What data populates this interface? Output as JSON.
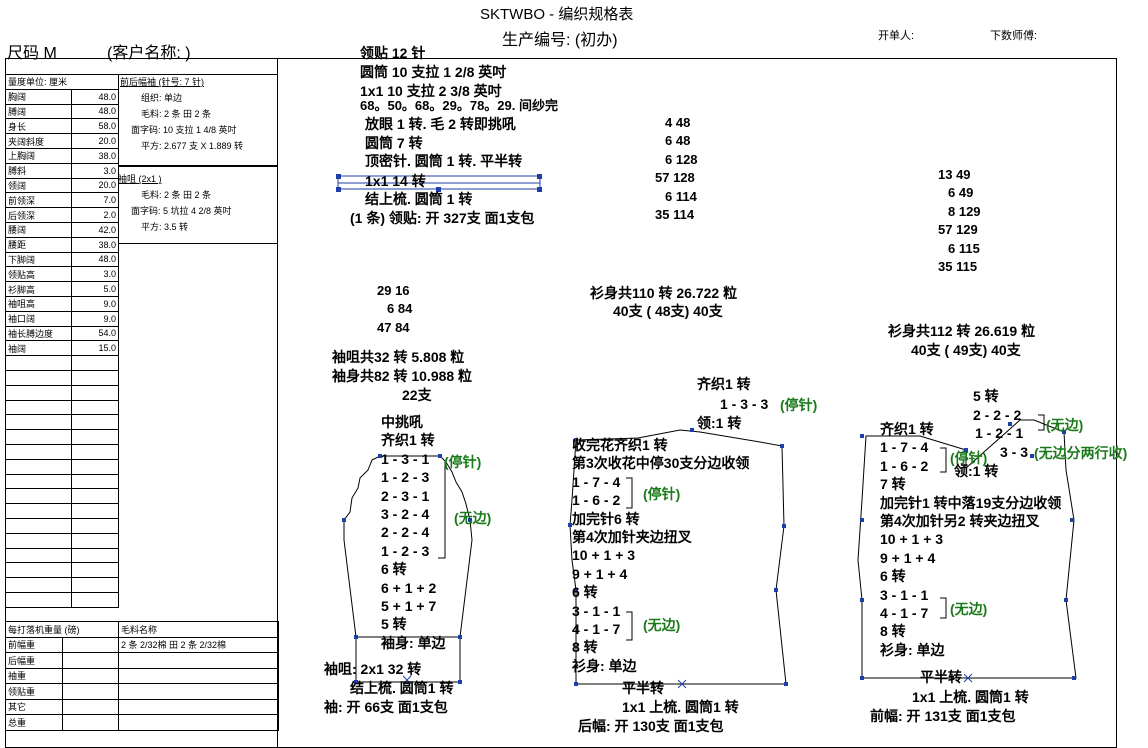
{
  "header": {
    "title": "SKTWBO - 编织规格表",
    "production_no": "生产编号: (初办)",
    "size": "尺码  M",
    "customer": "(客户名称:                  )",
    "issuer": "开单人:",
    "technician": "下数师傅:"
  },
  "measurements": {
    "header": "量度单位: 厘米",
    "rows": [
      {
        "label": "胸阔",
        "value": "48.0"
      },
      {
        "label": "膊阔",
        "value": "48.0"
      },
      {
        "label": "身长",
        "value": "58.0"
      },
      {
        "label": "夹阔斜度",
        "value": "20.0"
      },
      {
        "label": "上胸阔",
        "value": "38.0"
      },
      {
        "label": "膊斜",
        "value": "3.0"
      },
      {
        "label": "领阔",
        "value": "20.0"
      },
      {
        "label": "前领深",
        "value": "7.0"
      },
      {
        "label": "后领深",
        "value": "2.0"
      },
      {
        "label": "腰阔",
        "value": "42.0"
      },
      {
        "label": "腰距",
        "value": "38.0"
      },
      {
        "label": "下脚阔",
        "value": "48.0"
      },
      {
        "label": "领贴高",
        "value": "3.0"
      },
      {
        "label": "衫脚高",
        "value": "5.0"
      },
      {
        "label": "袖咀高",
        "value": "9.0"
      },
      {
        "label": "袖口阔",
        "value": "9.0"
      },
      {
        "label": "袖长膊边度",
        "value": "54.0"
      },
      {
        "label": "袖阔",
        "value": "15.0"
      }
    ]
  },
  "spec_body": {
    "title": "前后幅袖 (针号: 7 针)",
    "lines": [
      "组织: 单边",
      "毛料: 2 条 田 2 条",
      "面字码: 10 支拉 1 4/8 英吋",
      "平方: 2.677 支 X 1.889 转"
    ]
  },
  "spec_rib": {
    "title": "袖咀 (2x1 )",
    "lines": [
      "毛料: 2 条 田 2 条",
      "面字码: 5 坑拉 4 2/8 英吋",
      "平方: 3.5 转"
    ]
  },
  "weight": {
    "header_left": "每打落机重量 (磅)",
    "header_right": "毛料名称",
    "rows": [
      {
        "label": "前幅重",
        "value": "2 条 2/32棉 田 2 条 2/32棉"
      },
      {
        "label": "后幅重",
        "value": ""
      },
      {
        "label": "袖重",
        "value": ""
      },
      {
        "label": "领贴重",
        "value": ""
      },
      {
        "label": "其它",
        "value": ""
      },
      {
        "label": "总重",
        "value": ""
      }
    ]
  },
  "collar": {
    "lines": [
      "领贴  12 针",
      "圆筒  10 支拉  1 2/8 英吋",
      "1x1   10 支拉  2 3/8 英吋",
      " 68。50。68。29。78。29. 间纱完",
      "放眼 1 转. 毛 2 转即挑吼",
      "圆筒       7 转",
      "顶密针. 圆筒 1 转. 平半转",
      "1x1          14 转",
      "结上梳. 圆筒 1 转",
      "(1 条) 领贴: 开  327支  面1支包"
    ]
  },
  "center_nums": [
    "4    48",
    "6    48",
    "6    128",
    "57    128",
    "6    114",
    "35    114"
  ],
  "right_nums": [
    "13    49",
    "6    49",
    "8    129",
    "57    129",
    "6    115",
    "35    115"
  ],
  "sleeve_nums": [
    "29    16",
    "6    84",
    "47    84"
  ],
  "sleeve_summary": [
    "袖咀共32 转  5.808 粒",
    "袖身共82 转  10.988 粒",
    "22支"
  ],
  "back_summary": [
    "衫身共110 转  26.722 粒",
    "40支  ( 48支)  40支"
  ],
  "front_summary": [
    "衫身共112 转  26.619 粒",
    "40支  ( 49支)  40支"
  ],
  "sleeve": {
    "instr": [
      "中挑吼",
      "齐织1 转",
      "1 - 3 - 1",
      "1 - 2 - 3",
      "2 - 3 - 1",
      "3 - 2 - 4",
      "2 - 2 - 4",
      "1 - 2 - 3",
      "6 转",
      "6 + 1 + 2",
      "5 + 1 + 7",
      "5 转",
      "袖身: 单边"
    ],
    "tag_stop": "(停针)",
    "tag_noedge": "(无边)",
    "rib": "袖咀:  2x1      32 转",
    "finish": "结上梳. 圆筒1 转",
    "bottom": "袖: 开  66支  面1支包"
  },
  "back": {
    "top": [
      "齐织1 转",
      "1 - 3 - 3",
      "领:1 转"
    ],
    "tag_stop_top": "(停针)",
    "instr": [
      "收完花齐织1 转",
      "第3次收花中停30支分边收领",
      "1 - 7 - 4",
      "1 - 6 - 2",
      "加完针6 转",
      "第4次加针夹边扭叉",
      "10 + 1 + 3",
      "9 + 1 + 4",
      "6 转",
      "3 - 1 - 1",
      "4 - 1 - 7",
      "8 转",
      "衫身: 单边"
    ],
    "tag_stop": "(停针)",
    "tag_noedge": "(无边)",
    "half": "平半转",
    "rib": "1x1 上梳. 圆筒1 转",
    "bottom": "后幅: 开  130支  面1支包"
  },
  "front": {
    "top": [
      "5 转",
      "2 - 2 - 2",
      "1 - 2 - 1",
      "3 - 3"
    ],
    "tag_noedge_top": "(无边)",
    "tag_split": "(无边分两行收)",
    "instr": [
      "齐织1 转",
      "1 - 7 - 4",
      "1 - 6 - 2",
      "7 转",
      "加完针1 转中落19支分边收领",
      "第4次加针另2 转夹边扭叉",
      "10 + 1 + 3",
      "9 + 1 + 4",
      "6 转",
      "3 - 1 - 1",
      "4 - 1 - 7",
      "8 转",
      "衫身: 单边"
    ],
    "tag_stop": "(停针)",
    "neck": "领:1 转",
    "tag_noedge": "(无边)",
    "half": "平半转",
    "rib": "1x1 上梳. 圆筒1 转",
    "bottom": "前幅: 开  131支  面1支包"
  }
}
